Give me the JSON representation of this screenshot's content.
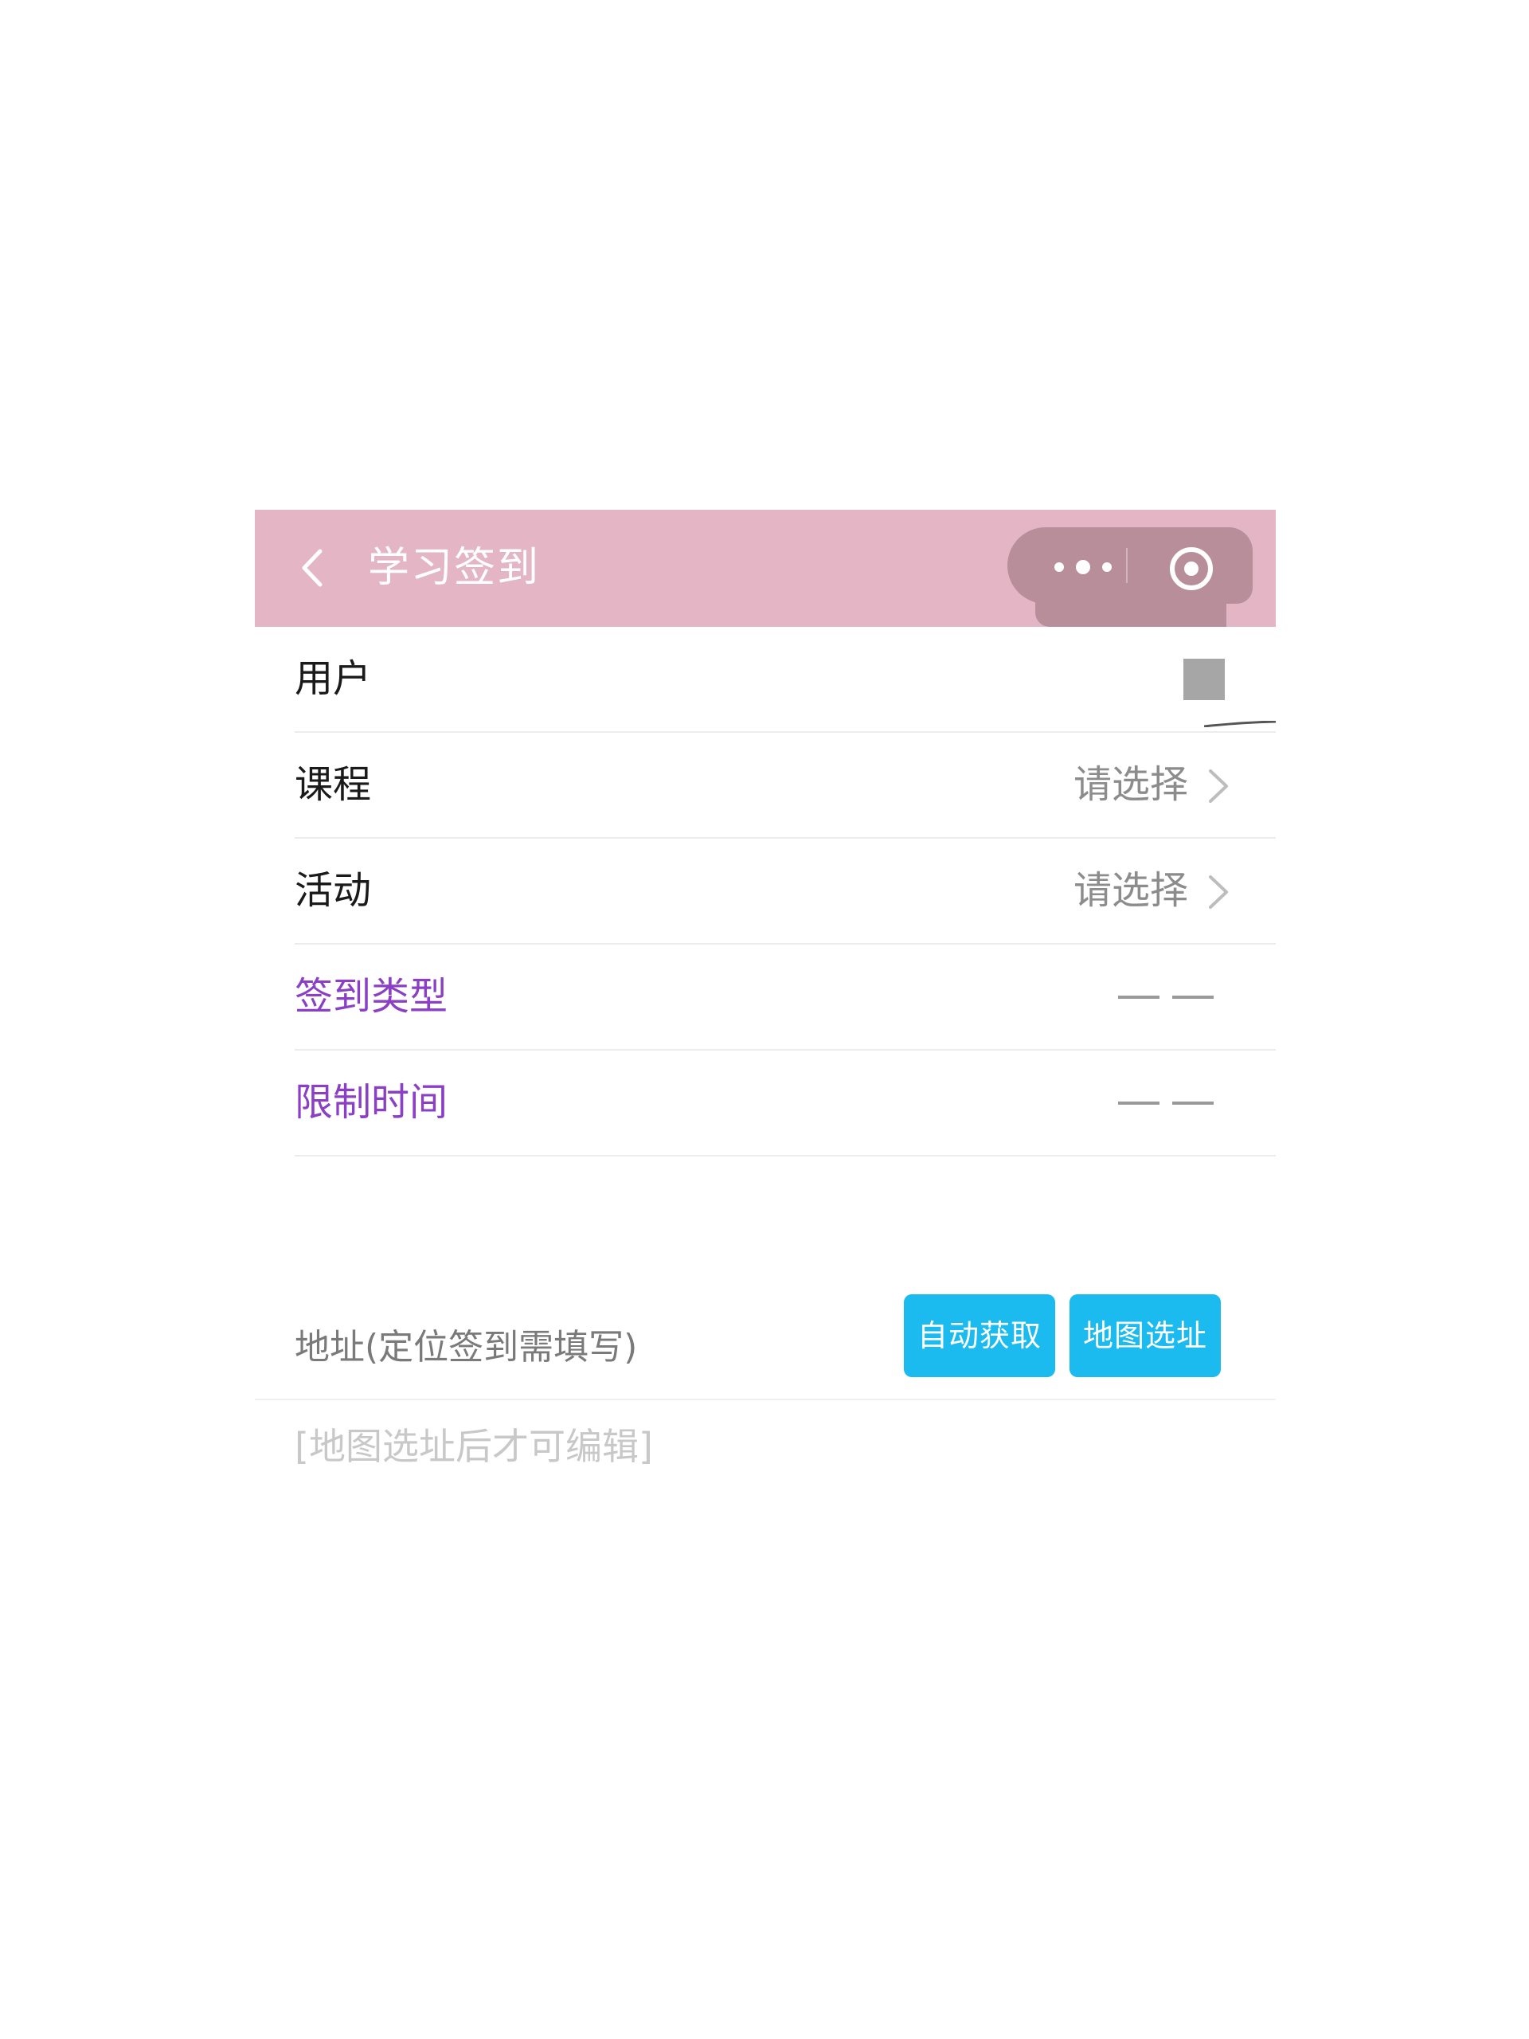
{
  "navbar": {
    "title": "学习签到",
    "background": "#e4b6c5",
    "capsule_color": "#b88e9b",
    "back_icon": "chevron-left-icon",
    "more_icon": "more-dots-icon",
    "close_icon": "record-circle-icon"
  },
  "rows": {
    "user": {
      "label": "用户"
    },
    "course": {
      "label": "课程",
      "value": "请选择"
    },
    "activity": {
      "label": "活动",
      "value": "请选择"
    },
    "checkin_type": {
      "label": "签到类型",
      "value": "— —"
    },
    "time_limit": {
      "label": "限制时间",
      "value": "— —"
    }
  },
  "address": {
    "label": "地址(定位签到需填写)",
    "auto_button": "自动获取",
    "map_button": "地图选址",
    "placeholder": "[地图选址后才可编辑]"
  },
  "colors": {
    "accent_button": "#1bbbf0",
    "purple_label": "#8a3fc4",
    "muted_text": "#8c8c8c"
  }
}
